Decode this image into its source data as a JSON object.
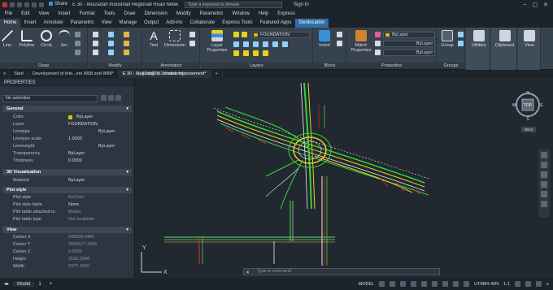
{
  "titlebar": {
    "share": "Share",
    "title": "E 30 - Mussafah Industriall Regionall Road Network Impro...",
    "search_placeholder": "Type a keyword or phrase",
    "sign_in": "Sign In"
  },
  "menu": [
    "File",
    "Edit",
    "View",
    "Insert",
    "Format",
    "Tools",
    "Draw",
    "Dimension",
    "Modify",
    "Parametric",
    "Window",
    "Help",
    "Express"
  ],
  "tabs": [
    "Home",
    "Insert",
    "Annotate",
    "Parametric",
    "View",
    "Manage",
    "Output",
    "Add-ins",
    "Collaborate",
    "Express Tools",
    "Featured Apps",
    "Geolocation"
  ],
  "ribbon": {
    "draw": {
      "label": "Draw",
      "line": "Line",
      "polyline": "Polyline",
      "circle": "Circle",
      "arc": "Arc"
    },
    "modify": {
      "label": "Modify"
    },
    "annotation": {
      "label": "Annotation",
      "text": "Text",
      "dimension": "Dimension"
    },
    "layers": {
      "label": "Layers",
      "layer_properties": "Layer\nProperties",
      "layer_name": "FOUNDATION"
    },
    "block": {
      "label": "Block",
      "insert": "Insert"
    },
    "properties": {
      "label": "Properties",
      "match": "Match\nProperties",
      "bylayer1": "ByLayer",
      "bylayer2": "ByLayer",
      "bylayer3": "ByLayer"
    },
    "groups": {
      "label": "Groups",
      "group": "Group"
    },
    "utilities": "Utilities",
    "clipboard": "Clipboard",
    "view": "View"
  },
  "doc_tabs": [
    "Start",
    "Development of Inte...ers W58 and W88*",
    "E 30 - Mussafah In...etwork Improvement*"
  ],
  "viewport_label": "[–][Top][2D Wireframe]",
  "properties": {
    "title": "PROPERTIES",
    "selection": "No selection",
    "general": {
      "title": "General",
      "rows": [
        {
          "k": "Color",
          "v": "ByLayer"
        },
        {
          "k": "Layer",
          "v": "FOUNDATION"
        },
        {
          "k": "Linetype",
          "v": "ByLayer"
        },
        {
          "k": "Linetype scale",
          "v": "1.0000"
        },
        {
          "k": "Lineweight",
          "v": "ByLayer"
        },
        {
          "k": "Transparency",
          "v": "ByLayer"
        },
        {
          "k": "Thickness",
          "v": "0.0000"
        }
      ]
    },
    "visualization": {
      "title": "3D Visualization",
      "rows": [
        {
          "k": "Material",
          "v": "ByLayer"
        }
      ]
    },
    "plot": {
      "title": "Plot style",
      "rows": [
        {
          "k": "Plot style",
          "v": "ByColor"
        },
        {
          "k": "Plot style table",
          "v": "None"
        },
        {
          "k": "Plot table attached to",
          "v": "Model"
        },
        {
          "k": "Plot table type",
          "v": "Not available"
        }
      ]
    },
    "view": {
      "title": "View",
      "rows": [
        {
          "k": "Center X",
          "v": "249330.0462"
        },
        {
          "k": "Center Y",
          "v": "2689577.4706"
        },
        {
          "k": "Center Z",
          "v": "0.0000"
        },
        {
          "k": "Height",
          "v": "2536.2948"
        },
        {
          "k": "Width",
          "v": "5377.1550"
        }
      ]
    }
  },
  "command_placeholder": "Type a command",
  "navcube": {
    "top": "TOP",
    "n": "N",
    "s": "S",
    "e": "E",
    "w": "W",
    "wcs": "WCS"
  },
  "ucs": {
    "x": "X",
    "y": "Y"
  },
  "status": {
    "model_tab": "Model",
    "layout_tab": "1",
    "model": "MODEL",
    "coord": "UTM84-40N",
    "scale": "1:1"
  },
  "colors": {
    "accent": "#2e6fa7",
    "road_green": "#3bd13b",
    "road_yellow": "#e6d21a",
    "road_white": "#f0f0f0",
    "road_red": "#e03030"
  }
}
